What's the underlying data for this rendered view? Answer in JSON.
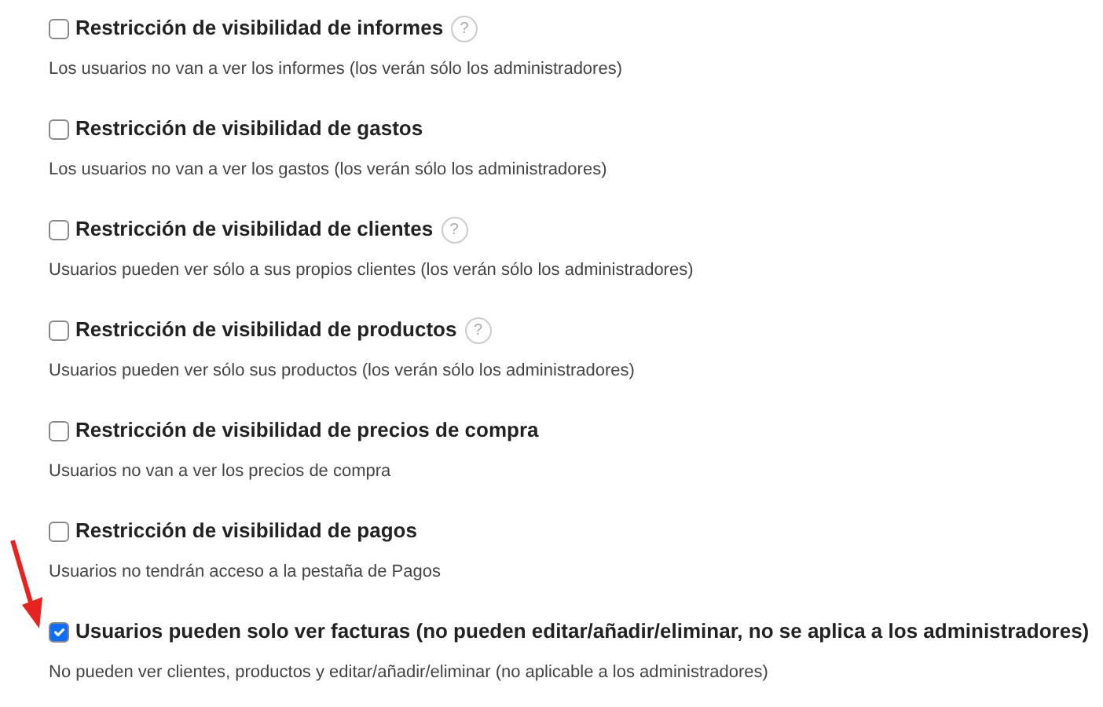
{
  "settings": [
    {
      "label": "Restricción de visibilidad de informes",
      "checked": false,
      "help": "?",
      "description": "Los usuarios no van a ver los informes (los verán sólo los administradores)"
    },
    {
      "label": "Restricción de visibilidad de gastos",
      "checked": false,
      "description": "Los usuarios no van a ver los gastos (los verán sólo los administradores)"
    },
    {
      "label": "Restricción de visibilidad de clientes",
      "checked": false,
      "help": "?",
      "description": "Usuarios pueden ver sólo a sus propios clientes (los verán sólo los administradores)"
    },
    {
      "label": "Restricción de visibilidad de productos",
      "checked": false,
      "help": "?",
      "description": "Usuarios pueden ver sólo sus productos (los verán sólo los administradores)"
    },
    {
      "label": "Restricción de visibilidad de precios de compra",
      "checked": false,
      "description": "Usuarios no van a ver los precios de compra"
    },
    {
      "label": "Restricción de visibilidad de pagos",
      "checked": false,
      "description": "Usuarios no tendrán acceso a la pestaña de Pagos"
    },
    {
      "label": "Usuarios pueden solo ver facturas (no pueden editar/añadir/eliminar, no se aplica a los administradores)",
      "checked": true,
      "pointer": true,
      "description": "No pueden ver clientes, productos y editar/añadir/eliminar (no aplicable a los administradores)"
    }
  ]
}
